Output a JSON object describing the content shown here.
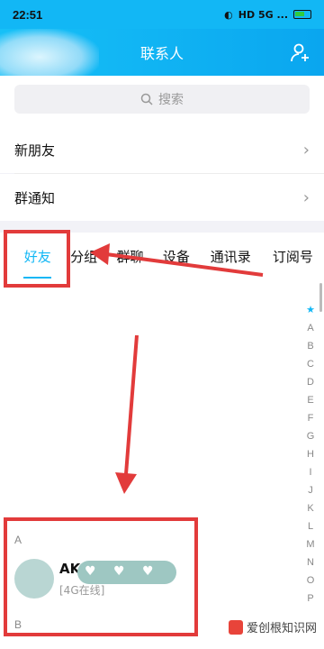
{
  "status": {
    "time": "22:51",
    "icons": "HD 5G ..."
  },
  "header": {
    "title": "联系人",
    "add_icon": "add-friend-icon"
  },
  "search": {
    "placeholder": "搜索"
  },
  "menu": [
    {
      "label": "新朋友"
    },
    {
      "label": "群通知"
    }
  ],
  "tabs": [
    {
      "label": "好友",
      "active": true
    },
    {
      "label": "分组"
    },
    {
      "label": "群聊"
    },
    {
      "label": "设备"
    },
    {
      "label": "通讯录"
    },
    {
      "label": "订阅号"
    }
  ],
  "alpha_index": [
    "★",
    "A",
    "B",
    "C",
    "D",
    "E",
    "F",
    "G",
    "H",
    "I",
    "J",
    "K",
    "L",
    "M",
    "N",
    "O",
    "P"
  ],
  "sections": {
    "a": "A",
    "b": "B"
  },
  "contact": {
    "name": "AKA",
    "status": "[4G在线]"
  },
  "watermark": {
    "text": "爱创根知识网"
  },
  "colors": {
    "accent": "#12b7f5",
    "annotation": "#e23b3b"
  }
}
